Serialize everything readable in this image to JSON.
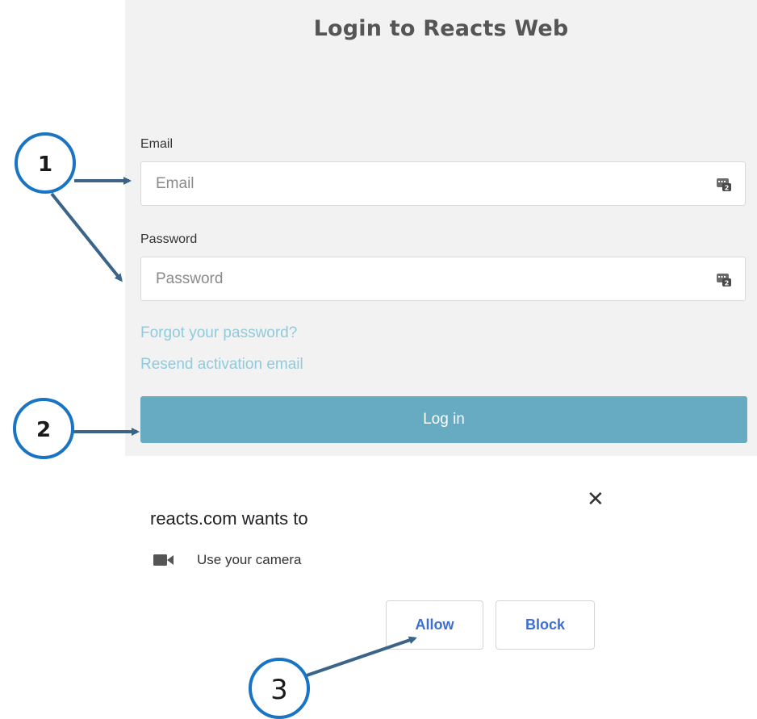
{
  "login": {
    "title": "Login to Reacts Web",
    "email_label": "Email",
    "email_placeholder": "Email",
    "email_value": "",
    "password_label": "Password",
    "password_placeholder": "Password",
    "password_value": "",
    "forgot_link": "Forgot your password?",
    "resend_link": "Resend activation email",
    "login_button": "Log in",
    "field_icon": "password-manager-key-icon"
  },
  "permission_prompt": {
    "title": "reacts.com wants to",
    "close_icon": "close-icon",
    "request_icon": "video-camera-icon",
    "request_text": "Use your camera",
    "allow_button": "Allow",
    "block_button": "Block"
  },
  "callouts": [
    {
      "number": "1"
    },
    {
      "number": "2"
    },
    {
      "number": "3"
    }
  ],
  "colors": {
    "panel_bg": "#f2f2f2",
    "login_button": "#67abc2",
    "link": "#8fcbdc",
    "permission_button_text": "#3b6fd6",
    "callout_circle": "#1a74c4",
    "callout_arrow": "#3a6488"
  }
}
